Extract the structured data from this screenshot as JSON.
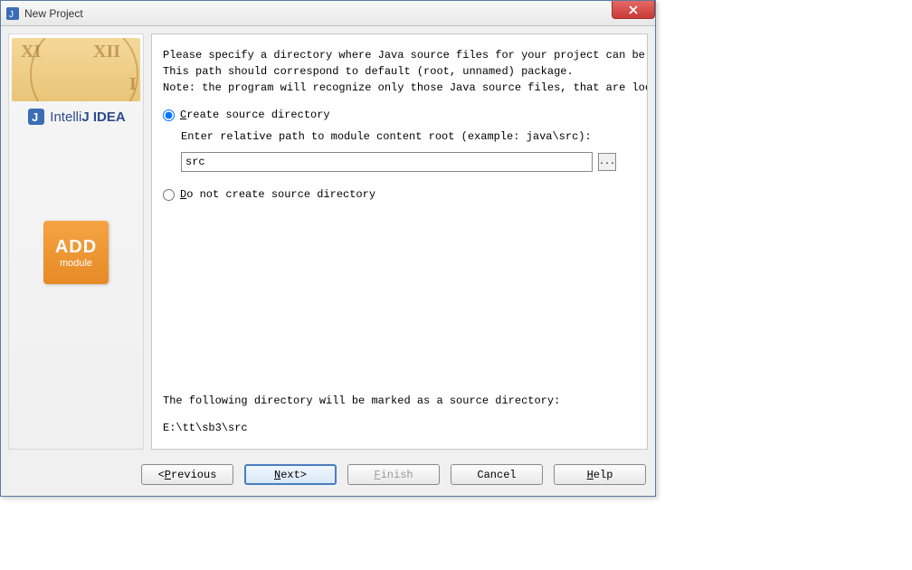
{
  "window": {
    "title": "New Project"
  },
  "sidebar": {
    "brand_prefix": "Intelli",
    "brand_middle": "J ",
    "brand_suffix": "IDEA",
    "add_label": "ADD",
    "module_label": "module"
  },
  "main": {
    "info_line1": "Please specify a directory where Java source files for your project can be found.",
    "info_line2": "This path should correspond to default (root, unnamed) package.",
    "info_line3": "Note: the program will recognize only those Java source files, that are located under",
    "radio1_prefix": "C",
    "radio1_rest": "reate source directory",
    "sub_label": "Enter relative path to module content root  (example: java\\src):",
    "path_value": "src",
    "radio2_prefix": "D",
    "radio2_rest": "o not create source directory",
    "footer_label": "The following directory will be marked as a source directory:",
    "resolved_path": "E:\\tt\\sb3\\src",
    "selected_option": "create"
  },
  "buttons": {
    "previous": "Previous",
    "previous_u": "P",
    "next": "ext",
    "next_u": "N",
    "finish": "inish",
    "finish_u": "F",
    "cancel": "Cancel",
    "help": "elp",
    "help_u": "H",
    "browse": "..."
  }
}
